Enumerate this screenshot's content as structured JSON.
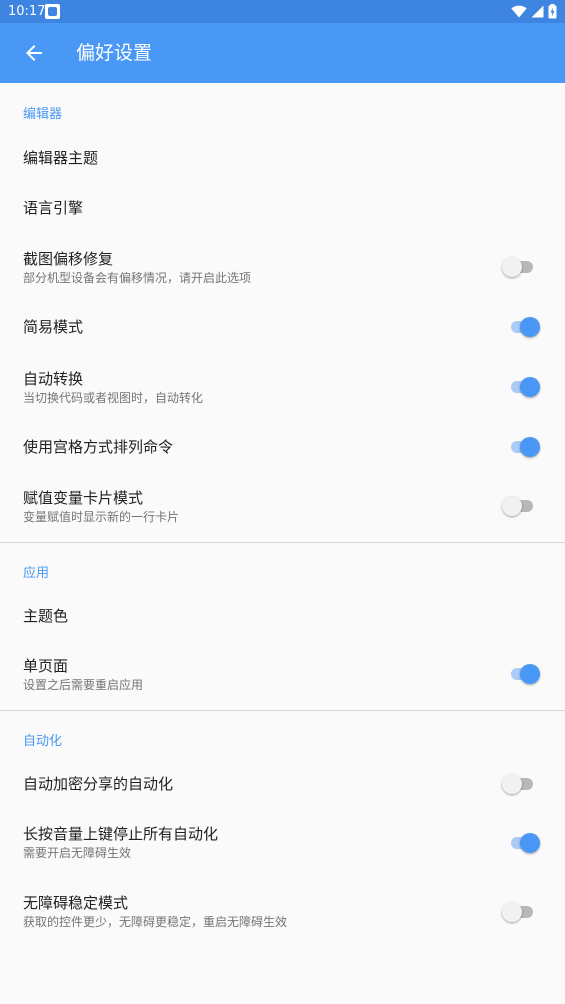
{
  "status_bar": {
    "time": "10:17",
    "app_icon": "app-notification-icon",
    "right_icons": [
      "wifi-icon",
      "signal-icon",
      "battery-charging-icon"
    ]
  },
  "app_bar": {
    "back_icon": "back-arrow-icon",
    "title": "偏好设置",
    "color": "#4a98f5"
  },
  "sections": [
    {
      "header": "编辑器",
      "items": [
        {
          "title": "编辑器主题"
        },
        {
          "title": "语言引擎"
        },
        {
          "title": "截图偏移修复",
          "summary": "部分机型设备会有偏移情况，请开启此选项",
          "switch": false
        },
        {
          "title": "简易模式",
          "switch": true
        },
        {
          "title": "自动转换",
          "summary": "当切换代码或者视图时，自动转化",
          "switch": true
        },
        {
          "title": "使用宫格方式排列命令",
          "switch": true
        },
        {
          "title": "赋值变量卡片模式",
          "summary": "变量赋值时显示新的一行卡片",
          "switch": false
        }
      ]
    },
    {
      "header": "应用",
      "items": [
        {
          "title": "主题色"
        },
        {
          "title": "单页面",
          "summary": "设置之后需要重启应用",
          "switch": true
        }
      ]
    },
    {
      "header": "自动化",
      "items": [
        {
          "title": "自动加密分享的自动化",
          "switch": false
        },
        {
          "title": "长按音量上键停止所有自动化",
          "summary": "需要开启无障碍生效",
          "switch": true
        },
        {
          "title": "无障碍稳定模式",
          "summary": "获取的控件更少，无障碍更稳定，重启无障碍生效",
          "switch": false
        }
      ]
    }
  ],
  "colors": {
    "accent": "#4a98f5",
    "status_bar": "#3d85e0",
    "switch_on": "#4a98f5",
    "switch_off_thumb": "#f1f1f1"
  }
}
